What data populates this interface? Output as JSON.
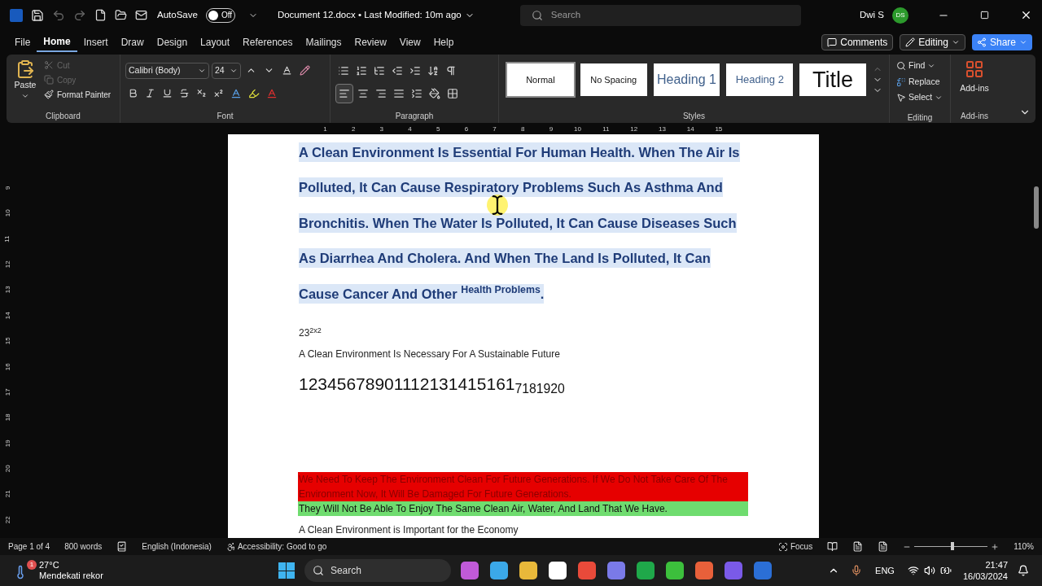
{
  "title_bar": {
    "autosave_label": "AutoSave",
    "autosave": {
      "on": false,
      "label": "Off"
    },
    "document_title": "Document 12.docx • Last Modified: 10m ago",
    "search_placeholder": "Search",
    "user_name": "Dwi S",
    "avatar_initials": "DS"
  },
  "menu_tabs": [
    {
      "label": "File",
      "selected": false
    },
    {
      "label": "Home",
      "selected": true
    },
    {
      "label": "Insert",
      "selected": false
    },
    {
      "label": "Draw",
      "selected": false
    },
    {
      "label": "Design",
      "selected": false
    },
    {
      "label": "Layout",
      "selected": false
    },
    {
      "label": "References",
      "selected": false
    },
    {
      "label": "Mailings",
      "selected": false
    },
    {
      "label": "Review",
      "selected": false
    },
    {
      "label": "View",
      "selected": false
    },
    {
      "label": "Help",
      "selected": false
    }
  ],
  "top_actions": {
    "comments": "Comments",
    "editing": "Editing",
    "share": "Share"
  },
  "ribbon": {
    "clipboard": {
      "paste": "Paste",
      "cut": {
        "label": "Cut",
        "disabled": true
      },
      "copy": {
        "label": "Copy",
        "disabled": true
      },
      "format_painter": "Format Painter",
      "group_label": "Clipboard"
    },
    "font": {
      "font_name": "Calibri (Body)",
      "font_size": "24",
      "group_label": "Font"
    },
    "paragraph": {
      "group_label": "Paragraph"
    },
    "styles": {
      "items": [
        {
          "label": "Normal",
          "kind": "normal",
          "selected": true
        },
        {
          "label": "No Spacing",
          "kind": "normal",
          "selected": false
        },
        {
          "label": "Heading 1",
          "kind": "heading1",
          "selected": false
        },
        {
          "label": "Heading 2",
          "kind": "heading2",
          "selected": false
        },
        {
          "label": "Title",
          "kind": "title",
          "selected": false
        }
      ],
      "group_label": "Styles"
    },
    "editing": {
      "find": "Find",
      "replace": "Replace",
      "select": "Select",
      "group_label": "Editing"
    },
    "addins": {
      "button": "Add-ins",
      "group_label": "Add-ins"
    }
  },
  "ruler": {
    "numbers": [
      "1",
      "2",
      "3",
      "4",
      "5",
      "6",
      "7",
      "8",
      "9",
      "10",
      "11",
      "12",
      "13",
      "14",
      "15"
    ]
  },
  "vertical_ruler": {
    "numbers": [
      "9",
      "10",
      "11",
      "12",
      "13",
      "14",
      "15",
      "16",
      "17",
      "18",
      "19",
      "20",
      "21",
      "22"
    ]
  },
  "document": {
    "paragraphs": [
      {
        "kind": "selected_line",
        "text": "A Clean Environment Is Essential For Human Health. When The Air Is"
      },
      {
        "kind": "selected_line",
        "text": "Polluted, It Can Cause Respiratory Problems Such As Asthma And"
      },
      {
        "kind": "selected_line",
        "text": "Bronchitis. When The Water Is Polluted, It Can Cause Diseases Such"
      },
      {
        "kind": "selected_line",
        "text": "As Diarrhea And Cholera. And When The Land Is Polluted, It Can"
      },
      {
        "kind": "selected_line",
        "text": "Cause Cancer And Other $^{Health Problems}$."
      },
      {
        "kind": "small",
        "text": "23$^{2x2}$"
      },
      {
        "kind": "plain",
        "text": "A Clean Environment Is Necessary For A Sustainable Future"
      },
      {
        "kind": "large",
        "text": "12345678901112131415161$_{7181920}$"
      },
      {
        "kind": "highlight",
        "color": "#e60000",
        "text": "We Need To Keep The Environment Clean For Future Generations. If We Do Not Take Care Of The Environment Now, It Will Be Damaged For Future Generations."
      },
      {
        "kind": "highlight",
        "color": "#6fdc6f",
        "text": "They Will Not Be Able To Enjoy The Same Clean Air, Water, And Land That We Have."
      },
      {
        "kind": "plain",
        "text": "A Clean Environment is Important for the Economy"
      }
    ]
  },
  "status_bar": {
    "page": "Page 1 of 4",
    "words": "800 words",
    "language": "English (Indonesia)",
    "accessibility": "Accessibility: Good to go",
    "focus": "Focus",
    "zoom": {
      "level": 0.5,
      "label": "110%"
    }
  },
  "taskbar": {
    "temperature": "27°C",
    "weather_note": "Mendekati rekor",
    "weather_badge": "1",
    "search_placeholder": "Search",
    "language": "ENG",
    "time": "21:47",
    "date": "16/03/2024"
  }
}
